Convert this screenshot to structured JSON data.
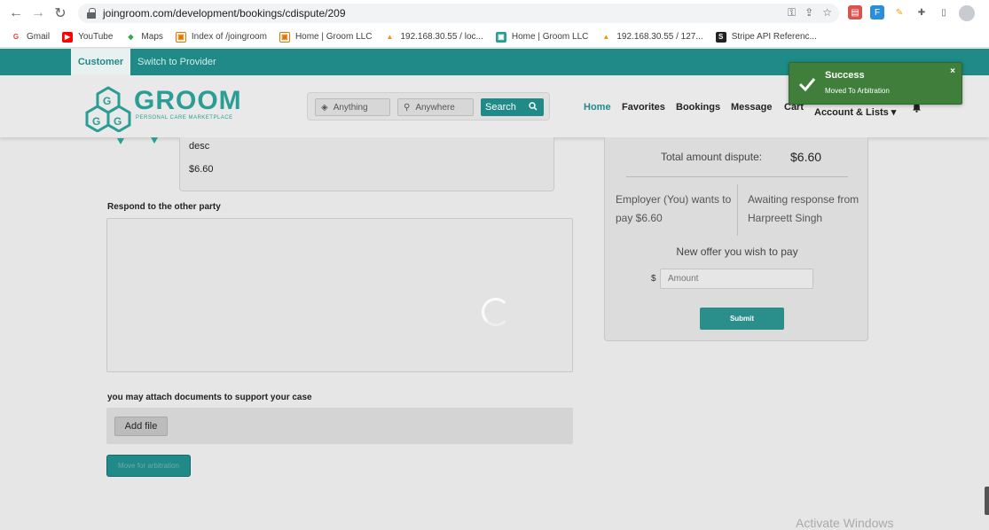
{
  "browser": {
    "url": "joingroom.com/development/bookings/cdispute/209",
    "bookmarks": [
      {
        "label": "Gmail",
        "icon": "gmail-icon",
        "color": "#ea4335",
        "glyph": "G"
      },
      {
        "label": "YouTube",
        "icon": "youtube-icon",
        "color": "#ff0000",
        "glyph": "▶"
      },
      {
        "label": "Maps",
        "icon": "maps-icon",
        "color": "#34a853",
        "glyph": "◆"
      },
      {
        "label": "Index of /joingroom",
        "icon": "folder-icon",
        "color": "#e37400",
        "glyph": "▣"
      },
      {
        "label": "Home | Groom LLC",
        "icon": "groom-icon",
        "color": "#e37400",
        "glyph": "▣"
      },
      {
        "label": "192.168.30.55 / loc...",
        "icon": "phpmyadmin-icon",
        "color": "#f29111",
        "glyph": "▲"
      },
      {
        "label": "Home | Groom LLC",
        "icon": "groom-icon",
        "color": "#2a9d94",
        "glyph": "▣"
      },
      {
        "label": "192.168.30.55 / 127...",
        "icon": "phpmyadmin-icon",
        "color": "#f29111",
        "glyph": "▲"
      },
      {
        "label": "Stripe API Referenc...",
        "icon": "stripe-icon",
        "color": "#222222",
        "glyph": "S"
      }
    ]
  },
  "topbar": {
    "customer_label": "Customer",
    "provider_label": "Switch to Provider"
  },
  "header": {
    "logo_text": "GROOM",
    "logo_sub": "PERSONAL CARE MARKETPLACE",
    "search": {
      "anything_placeholder": "Anything",
      "anywhere_placeholder": "Anywhere",
      "button_label": "Search"
    },
    "nav": {
      "home": "Home",
      "favorites": "Favorites",
      "bookings": "Bookings",
      "message": "Message",
      "cart": "Cart",
      "account": "Account & Lists ▾"
    }
  },
  "dispute": {
    "desc": "desc",
    "amount": "$6.60",
    "respond_label": "Respond to the other party",
    "attach_label": "you may attach documents to support your case",
    "add_file_label": "Add file",
    "move_arbitration_label": "Move for arbitration"
  },
  "panel": {
    "total_label": "Total amount dispute:",
    "total_value": "$6.60",
    "employer_text": "Employer (You) wants to pay $6.60",
    "awaiting_text": "Awaiting response from Harpreett Singh",
    "new_offer_label": "New offer you wish to pay",
    "currency": "$",
    "amount_placeholder": "Amount",
    "submit_label": "Submit"
  },
  "toast": {
    "title": "Success",
    "message": "Moved To Arbitration",
    "close": "×"
  },
  "watermark": "Activate Windows",
  "colors": {
    "brand_teal": "#1f8a87",
    "toast_green": "#3f7f3b"
  }
}
